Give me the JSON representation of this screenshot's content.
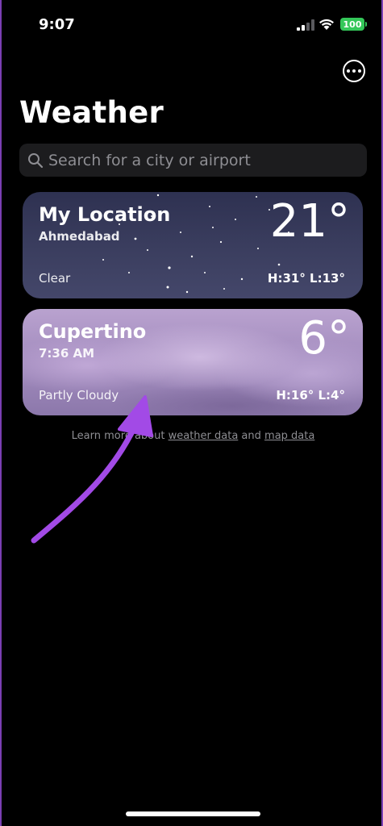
{
  "status_bar": {
    "time": "9:07",
    "battery": "100"
  },
  "header": {
    "title": "Weather"
  },
  "search": {
    "placeholder": "Search for a city or airport"
  },
  "cards": [
    {
      "name": "My Location",
      "subtitle": "Ahmedabad",
      "temp": "21°",
      "condition": "Clear",
      "high_low": "H:31°  L:13°"
    },
    {
      "name": "Cupertino",
      "subtitle": "7:36 AM",
      "temp": "6°",
      "condition": "Partly Cloudy",
      "high_low": "H:16°  L:4°"
    }
  ],
  "footer": {
    "prefix": "Learn more about ",
    "weather_link": "weather data",
    "middle": " and ",
    "map_link": "map data"
  },
  "colors": {
    "accent_arrow": "#a24ae6",
    "battery": "#34c759",
    "search_bg": "#1c1c1e"
  }
}
